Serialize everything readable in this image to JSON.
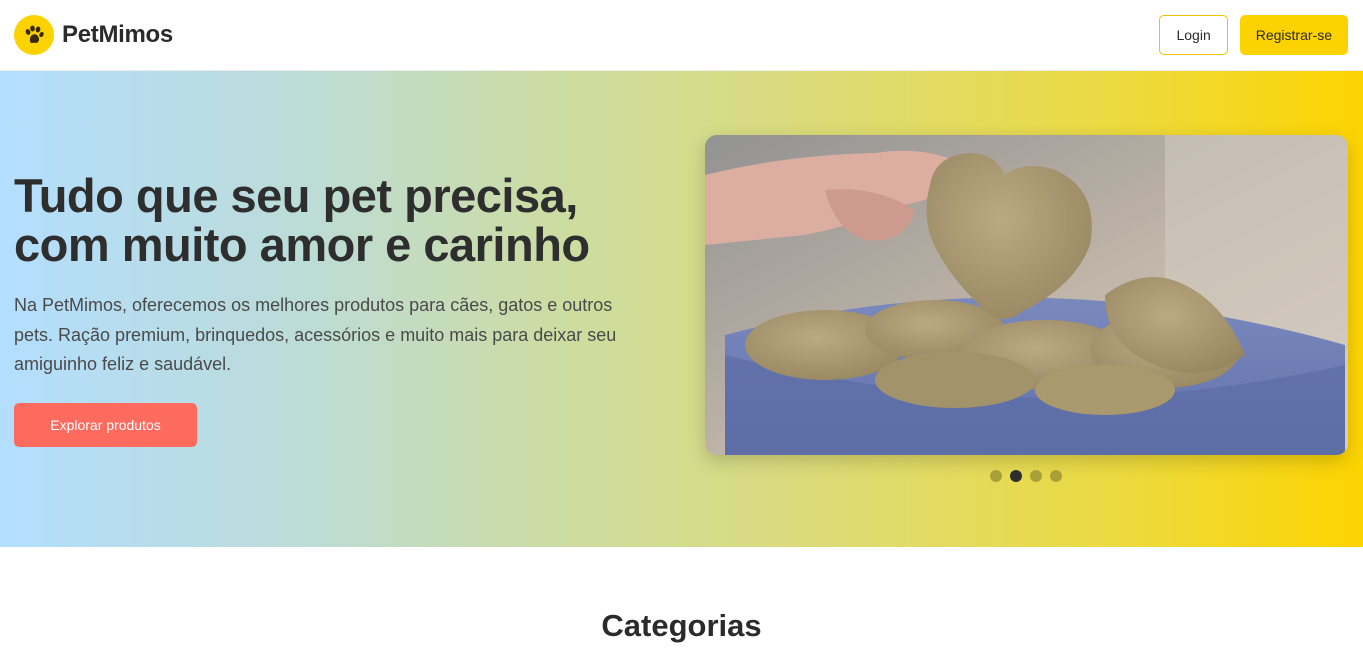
{
  "header": {
    "brand_name": "PetMimos",
    "login_label": "Login",
    "register_label": "Registrar-se"
  },
  "hero": {
    "title": "Tudo que seu pet precisa, com muito amor e carinho",
    "description": "Na PetMimos, oferecemos os melhores produtos para cães, gatos e outros pets. Ração premium, brinquedos, acessórios e muito mais para deixar seu amiguinho feliz e saudável.",
    "cta_label": "Explorar produtos",
    "carousel": {
      "slide_count": 4,
      "active_slide": 2
    }
  },
  "categories": {
    "title": "Categorias"
  },
  "colors": {
    "brand_yellow": "#fcd200",
    "cta_coral": "#fd6b5e",
    "text_dark": "#2b2b2b"
  },
  "icons": {
    "logo": "paw-icon"
  }
}
